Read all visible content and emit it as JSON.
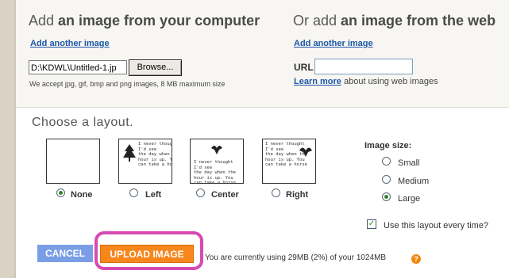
{
  "computer": {
    "title_prefix": "Add ",
    "title_bold": "an image from your computer",
    "add_another": "Add another image",
    "file_value": "D:\\KDWL\\Untitled-1.jp",
    "browse_label": "Browse...",
    "accept_note": "We accept jpg, gif, bmp and png images, 8 MB maximum size"
  },
  "web": {
    "title_prefix": "Or add ",
    "title_bold": "an image from the web",
    "add_another": "Add another image",
    "url_label": "URL",
    "url_value": "",
    "learn_more": "Learn more",
    "learn_suffix": " about using web images"
  },
  "layout": {
    "heading": "Choose a layout.",
    "options": [
      {
        "label": "None",
        "selected": true
      },
      {
        "label": "Left",
        "selected": false
      },
      {
        "label": "Center",
        "selected": false
      },
      {
        "label": "Right",
        "selected": false
      }
    ],
    "sample_text": "I never thought\nI'd see\nthe day when the\nhour is up. You\ncan take a horse"
  },
  "image_size": {
    "title": "Image size:",
    "options": [
      {
        "label": "Small",
        "selected": false
      },
      {
        "label": "Medium",
        "selected": false
      },
      {
        "label": "Large",
        "selected": true
      }
    ]
  },
  "remember": {
    "label": "Use this layout every time?",
    "checked": true
  },
  "actions": {
    "cancel": "CANCEL",
    "upload": "UPLOAD IMAGE"
  },
  "usage": {
    "text": "You are currently using 29MB (2%) of your 1024MB",
    "help_icon": "?"
  },
  "colors": {
    "link": "#1c57a8",
    "upload_button": "#f7861c",
    "cancel_button": "#7a9ee6",
    "highlight": "#d64ab1",
    "radio_selected": "#2a8a2a"
  }
}
